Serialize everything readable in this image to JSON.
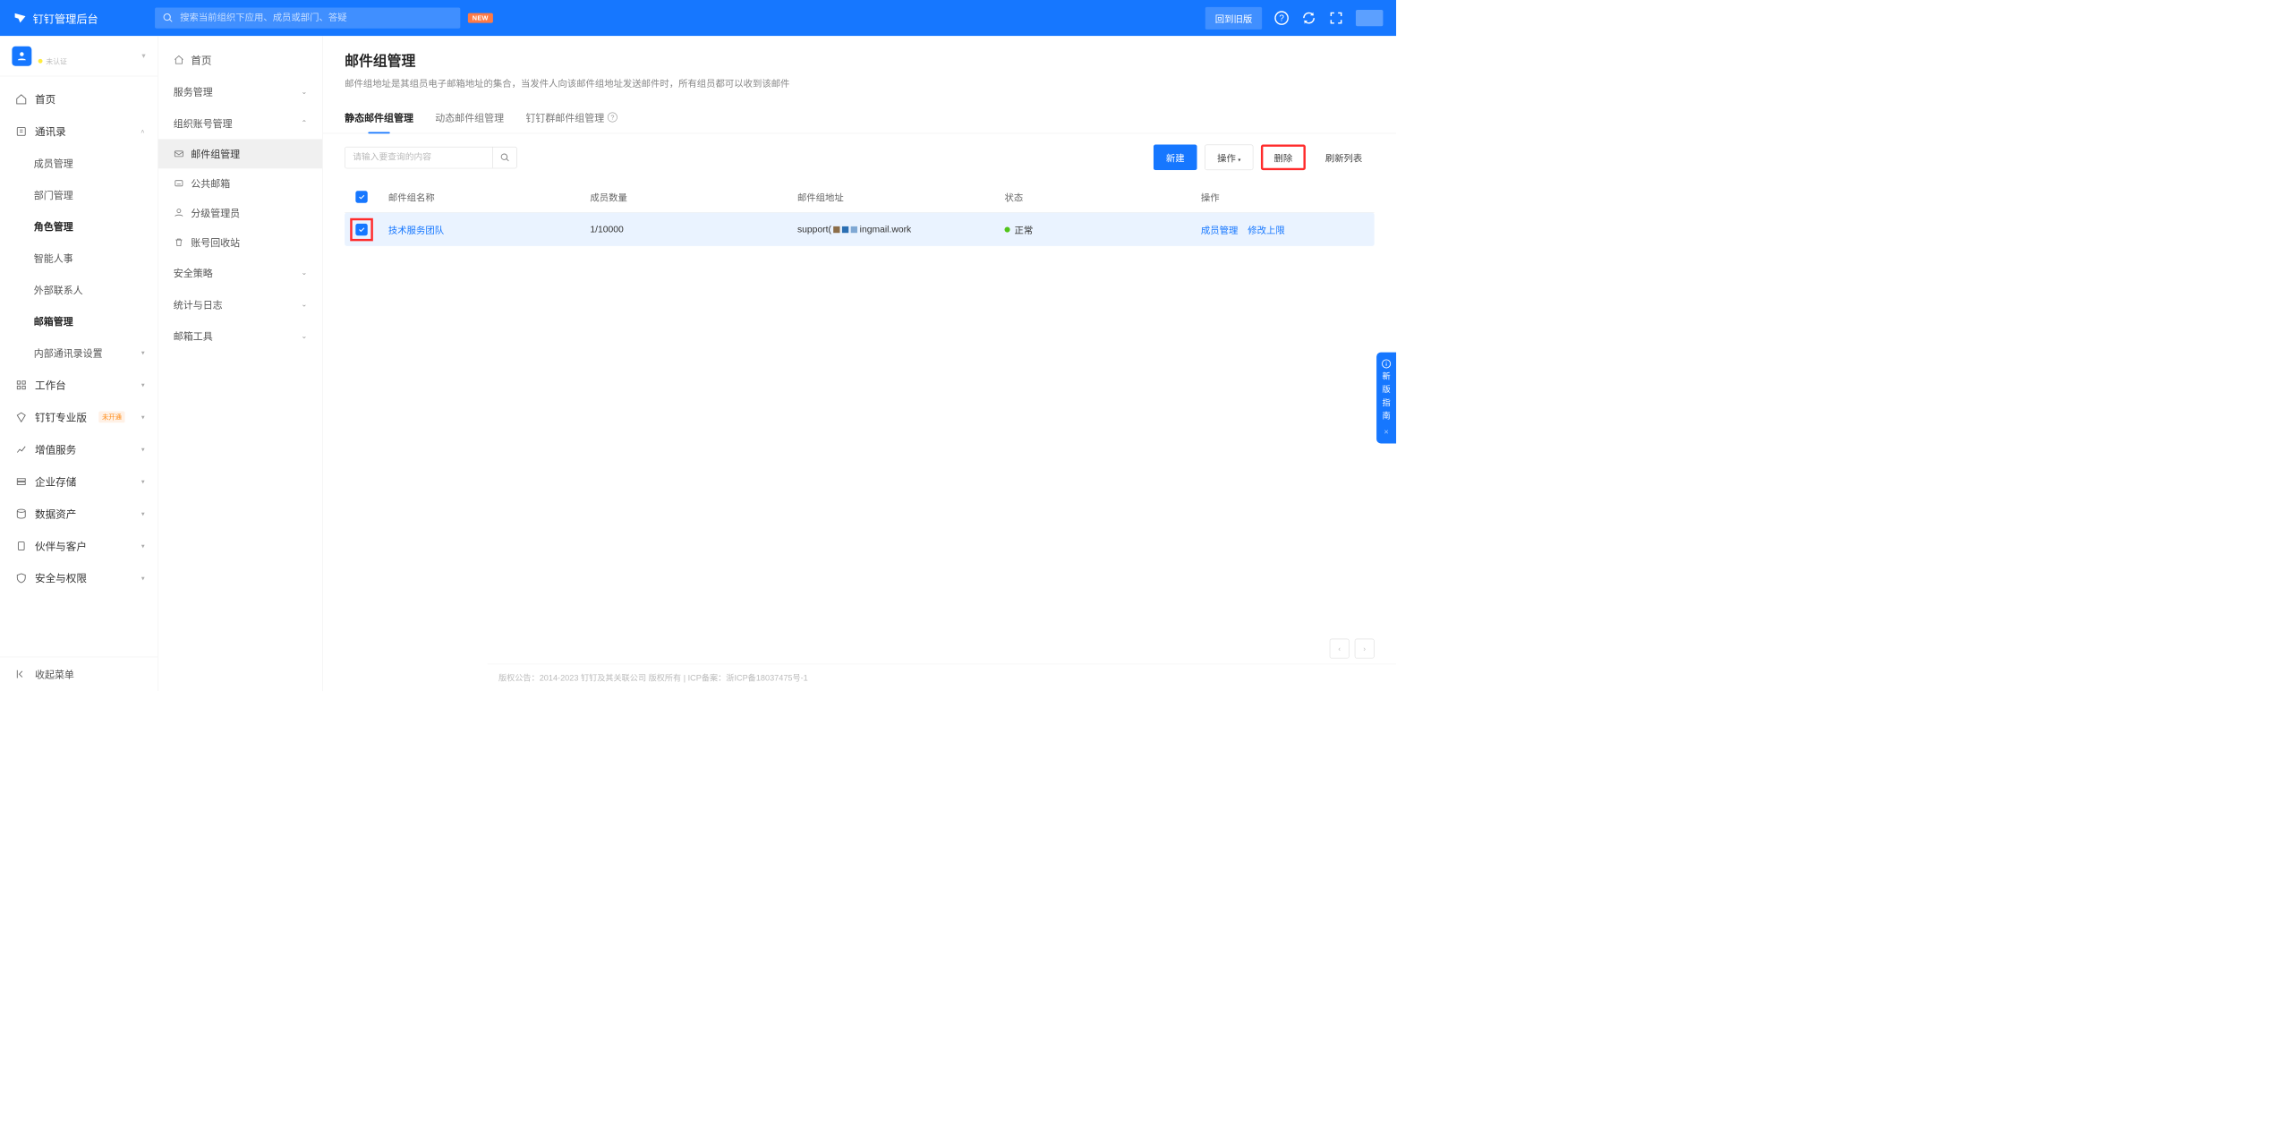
{
  "topbar": {
    "brand": "钉钉管理后台",
    "search_placeholder": "搜索当前组织下应用、成员或部门、答疑",
    "new_badge": "NEW",
    "old_version": "回到旧版"
  },
  "org": {
    "status": "未认证"
  },
  "sidebar1": {
    "home": "首页",
    "contacts": "通讯录",
    "member_mgmt": "成员管理",
    "dept_mgmt": "部门管理",
    "role_mgmt": "角色管理",
    "smart_hr": "智能人事",
    "external_contacts": "外部联系人",
    "mail_mgmt": "邮箱管理",
    "internal_contacts_settings": "内部通讯录设置",
    "workbench": "工作台",
    "pro": "钉钉专业版",
    "pro_badge": "未开通",
    "value_added": "增值服务",
    "storage": "企业存储",
    "data_asset": "数据资产",
    "partner": "伙伴与客户",
    "security": "安全与权限",
    "collapse": "收起菜单"
  },
  "sidebar2": {
    "home": "首页",
    "service_mgmt": "服务管理",
    "org_account": "组织账号管理",
    "mail_group": "邮件组管理",
    "public_mailbox": "公共邮箱",
    "tier_admin": "分级管理员",
    "account_recycle": "账号回收站",
    "security_policy": "安全策略",
    "stats_logs": "统计与日志",
    "mail_tools": "邮箱工具"
  },
  "content": {
    "title": "邮件组管理",
    "desc": "邮件组地址是其组员电子邮箱地址的集合，当发件人向该邮件组地址发送邮件时，所有组员都可以收到该邮件"
  },
  "tabs": {
    "static": "静态邮件组管理",
    "dynamic": "动态邮件组管理",
    "dingtalk_group": "钉钉群邮件组管理"
  },
  "toolbar": {
    "query_placeholder": "请输入要查询的内容",
    "create": "新建",
    "operate": "操作",
    "delete": "删除",
    "refresh": "刷新列表"
  },
  "table": {
    "col_name": "邮件组名称",
    "col_count": "成员数量",
    "col_addr": "邮件组地址",
    "col_status": "状态",
    "col_ops": "操作",
    "row": {
      "name": "技术服务团队",
      "count": "1/10000",
      "addr_prefix": "support(",
      "addr_suffix": "ingmail.work",
      "status": "正常",
      "op_member": "成员管理",
      "op_limit": "修改上限"
    }
  },
  "footer": {
    "text": "版权公告：2014-2023 钉钉及其关联公司 版权所有 | ICP备案：浙ICP备18037475号-1"
  },
  "guide": {
    "l1": "新",
    "l2": "版",
    "l3": "指",
    "l4": "南",
    "close": "×"
  }
}
